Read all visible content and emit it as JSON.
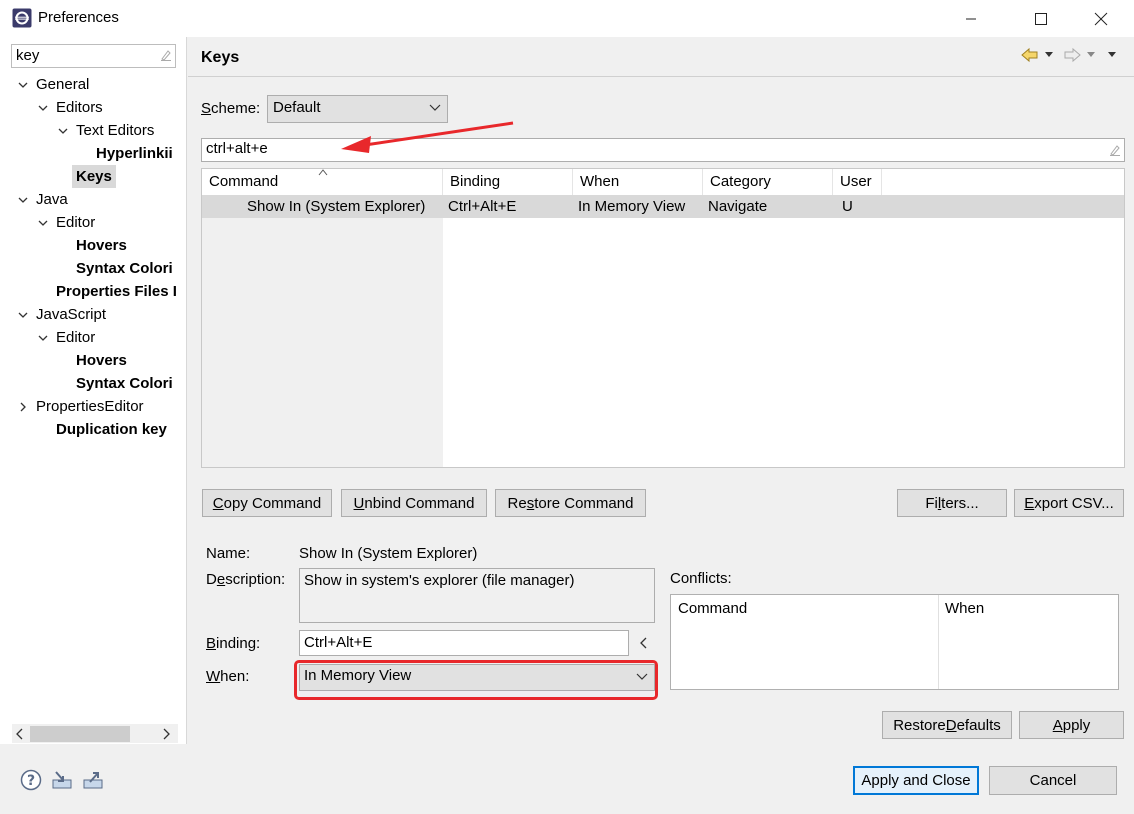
{
  "window": {
    "title": "Preferences"
  },
  "filter": {
    "value": "key"
  },
  "tree": [
    {
      "label": "General",
      "bold": false,
      "level": 0,
      "arrow": "down"
    },
    {
      "label": "Editors",
      "bold": false,
      "level": 1,
      "arrow": "down"
    },
    {
      "label": "Text Editors",
      "bold": false,
      "level": 2,
      "arrow": "down"
    },
    {
      "label": "Hyperlinkii",
      "bold": true,
      "level": 3,
      "arrow": ""
    },
    {
      "label": "Keys",
      "bold": true,
      "level": 2,
      "arrow": "",
      "selected": true
    },
    {
      "label": "Java",
      "bold": false,
      "level": 0,
      "arrow": "down"
    },
    {
      "label": "Editor",
      "bold": false,
      "level": 1,
      "arrow": "down"
    },
    {
      "label": "Hovers",
      "bold": true,
      "level": 2,
      "arrow": ""
    },
    {
      "label": "Syntax Colori",
      "bold": true,
      "level": 2,
      "arrow": ""
    },
    {
      "label": "Properties Files I",
      "bold": true,
      "level": 1,
      "arrow": ""
    },
    {
      "label": "JavaScript",
      "bold": false,
      "level": 0,
      "arrow": "down"
    },
    {
      "label": "Editor",
      "bold": false,
      "level": 1,
      "arrow": "down"
    },
    {
      "label": "Hovers",
      "bold": true,
      "level": 2,
      "arrow": ""
    },
    {
      "label": "Syntax Colori",
      "bold": true,
      "level": 2,
      "arrow": ""
    },
    {
      "label": "PropertiesEditor",
      "bold": false,
      "level": 0,
      "arrow": "right"
    },
    {
      "label": "Duplication key",
      "bold": true,
      "level": 1,
      "arrow": ""
    }
  ],
  "page": {
    "title": "Keys"
  },
  "scheme": {
    "label_pre": "S",
    "label_post": "cheme:",
    "value": "Default"
  },
  "search": {
    "value": "ctrl+alt+e"
  },
  "table": {
    "headers": [
      "Command",
      "Binding",
      "When",
      "Category",
      "User"
    ],
    "rows": [
      [
        "Show In (System Explorer)",
        "Ctrl+Alt+E",
        "In Memory View",
        "Navigate",
        "U"
      ]
    ]
  },
  "buttons": {
    "copy_command_u": "C",
    "copy_command_rest": "opy Command",
    "unbind_command_u": "U",
    "unbind_command_rest": "nbind Command",
    "restore_command_pre": "Re",
    "restore_command_u": "s",
    "restore_command_post": "tore Command",
    "filters_pre": "Fi",
    "filters_u": "l",
    "filters_post": "ters...",
    "export_u": "E",
    "export_rest": "xport CSV...",
    "restore_defaults_pre": "Restore ",
    "restore_defaults_u": "D",
    "restore_defaults_post": "efaults",
    "apply_u": "A",
    "apply_rest": "pply",
    "apply_and_close": "Apply and Close",
    "cancel": "Cancel"
  },
  "details": {
    "name_label": "Name:",
    "name_value": "Show In (System Explorer)",
    "description_label_pre": "D",
    "description_label_u": "e",
    "description_label_post": "scription:",
    "description_value": "Show in system's explorer (file manager)",
    "binding_label_u": "B",
    "binding_label_rest": "inding:",
    "binding_value": "Ctrl+Alt+E",
    "when_label_u": "W",
    "when_label_rest": "hen:",
    "when_value": "In Memory View",
    "conflicts_label": "Conflicts:",
    "conflicts_headers": [
      "Command",
      "When"
    ]
  },
  "colors": {
    "annotation_red": "#e8282b",
    "selection_gray": "#d9d9d9",
    "accent_blue": "#0078d7"
  }
}
